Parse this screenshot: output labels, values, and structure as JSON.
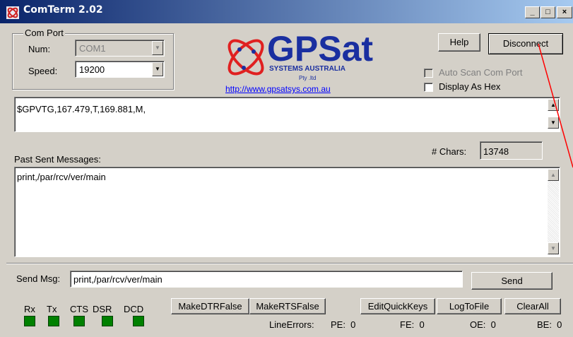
{
  "window": {
    "title": "ComTerm 2.02",
    "min_label": "_",
    "max_label": "□",
    "close_label": "×"
  },
  "com_port": {
    "group_label": "Com Port",
    "num_label": "Num:",
    "num_value": "COM1",
    "speed_label": "Speed:",
    "speed_value": "19200"
  },
  "logo": {
    "brand": "GPSat",
    "tagline": "SYSTEMS AUSTRALIA",
    "suffix": "Pty .ltd",
    "url": "http://www.gpsatsys.com.au"
  },
  "top_buttons": {
    "help": "Help",
    "disconnect": "Disconnect"
  },
  "options": {
    "auto_scan": "Auto Scan Com Port",
    "display_hex": "Display As Hex"
  },
  "receive": {
    "text": "$GPVTG,167.479,T,169.881,M,"
  },
  "chars": {
    "label": "# Chars:",
    "value": "13748"
  },
  "past": {
    "label": "Past Sent Messages:",
    "text": "print,/par/rcv/ver/main"
  },
  "send": {
    "label": "Send Msg:",
    "value": "print,/par/rcv/ver/main",
    "button": "Send"
  },
  "signals": {
    "rx": "Rx",
    "tx": "Tx",
    "cts": "CTS",
    "dsr": "DSR",
    "dcd": "DCD"
  },
  "bottom_buttons": {
    "dtr": "MakeDTRFalse",
    "rts": "MakeRTSFalse",
    "quickkeys": "EditQuickKeys",
    "logtofile": "LogToFile",
    "clearall": "ClearAll"
  },
  "errors": {
    "label": "LineErrors:",
    "pe": "PE:  0",
    "fe": "FE:  0",
    "oe": "OE:  0",
    "be": "BE:  0"
  },
  "colors": {
    "led_on": "#008000",
    "link": "#0000ff",
    "logo_red": "#e02020",
    "logo_blue": "#1a2fa0"
  }
}
